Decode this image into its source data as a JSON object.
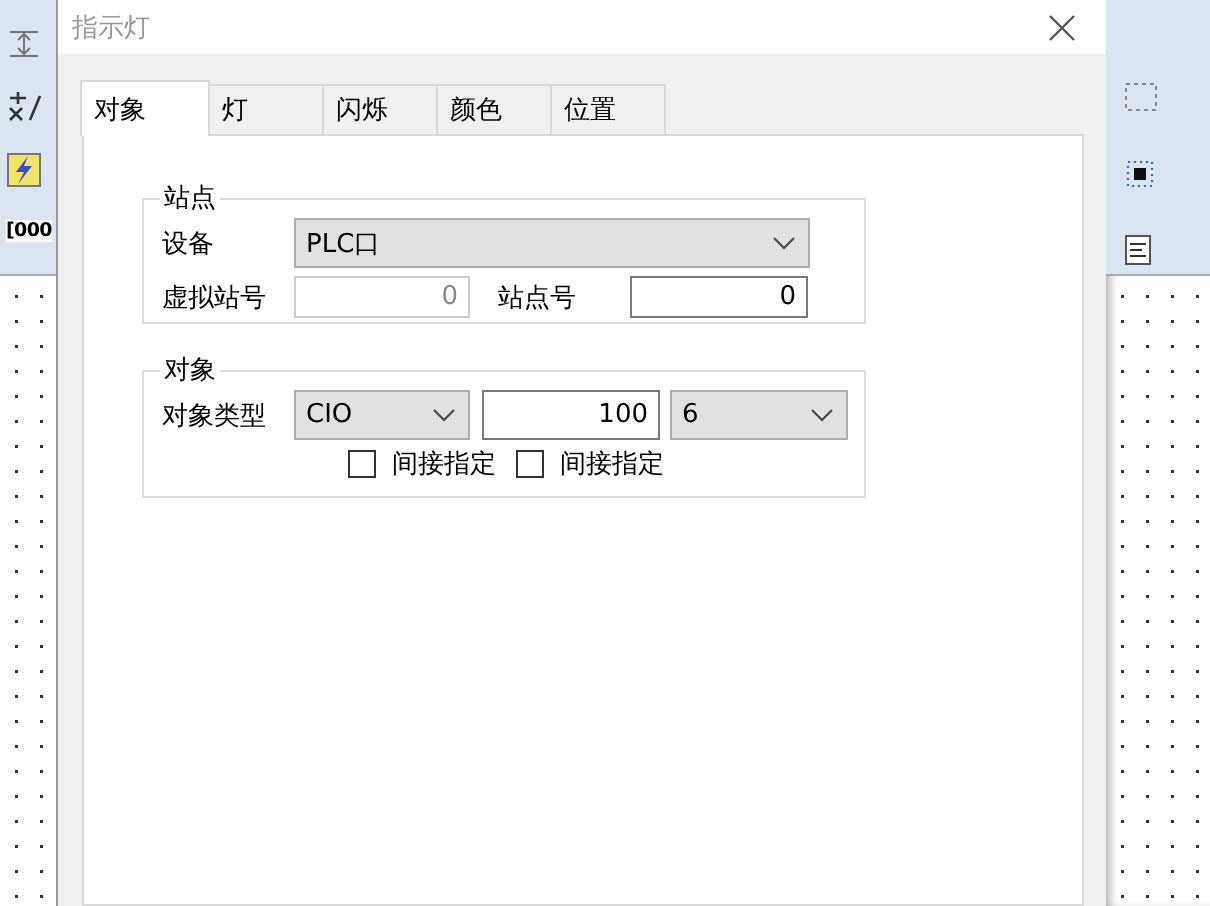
{
  "background_app": {
    "toolbar_text": "[000"
  },
  "window": {
    "title": "指示灯"
  },
  "tabs": [
    {
      "label": "对象",
      "selected": true
    },
    {
      "label": "灯",
      "selected": false
    },
    {
      "label": "闪烁",
      "selected": false
    },
    {
      "label": "颜色",
      "selected": false
    },
    {
      "label": "位置",
      "selected": false
    }
  ],
  "station_group": {
    "title": "站点",
    "device": {
      "label": "设备",
      "value": "PLC口"
    },
    "virtual_station": {
      "label": "虚拟站号",
      "value": "0",
      "disabled": true
    },
    "station_number": {
      "label": "站点号",
      "value": "0",
      "disabled": false
    }
  },
  "object_group": {
    "title": "对象",
    "type_label": "对象类型",
    "object_type": {
      "value": "CIO"
    },
    "address": {
      "value": "100",
      "disabled": false
    },
    "bit": {
      "value": "6"
    },
    "indirect": [
      {
        "label": "间接指定",
        "checked": false
      },
      {
        "label": "间接指定",
        "checked": false
      }
    ]
  }
}
